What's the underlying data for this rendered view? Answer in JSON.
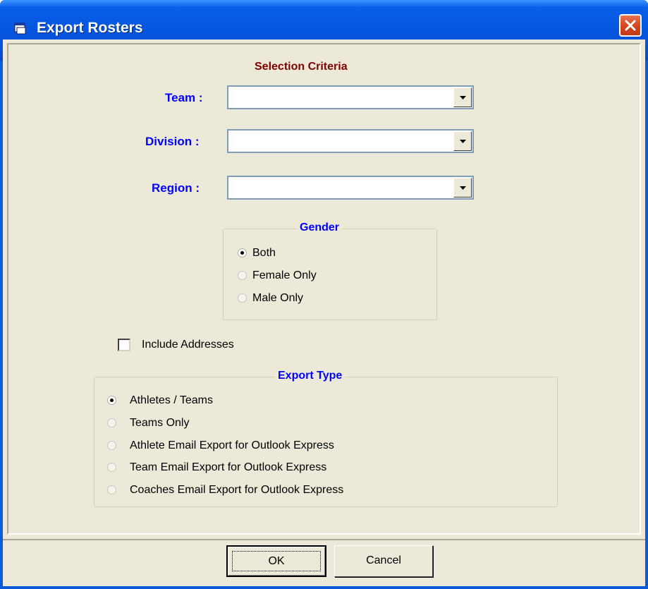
{
  "window": {
    "title": "Export Rosters",
    "icons": {
      "app": "app-icon",
      "close": "close-icon"
    }
  },
  "criteria": {
    "heading": "Selection Criteria",
    "team": {
      "label": "Team :",
      "value": ""
    },
    "division": {
      "label": "Division :",
      "value": ""
    },
    "region": {
      "label": "Region :",
      "value": ""
    }
  },
  "gender": {
    "legend": "Gender",
    "options": [
      {
        "label": "Both",
        "selected": true
      },
      {
        "label": "Female Only",
        "selected": false
      },
      {
        "label": "Male Only",
        "selected": false
      }
    ]
  },
  "include_addresses": {
    "label": "Include Addresses",
    "checked": false
  },
  "export_type": {
    "legend": "Export Type",
    "options": [
      {
        "label": "Athletes / Teams",
        "selected": true
      },
      {
        "label": "Teams Only",
        "selected": false
      },
      {
        "label": "Athlete Email Export for Outlook Express",
        "selected": false
      },
      {
        "label": "Team Email Export for Outlook Express",
        "selected": false
      },
      {
        "label": "Coaches Email Export for Outlook Express",
        "selected": false
      }
    ]
  },
  "buttons": {
    "ok": "OK",
    "cancel": "Cancel"
  }
}
